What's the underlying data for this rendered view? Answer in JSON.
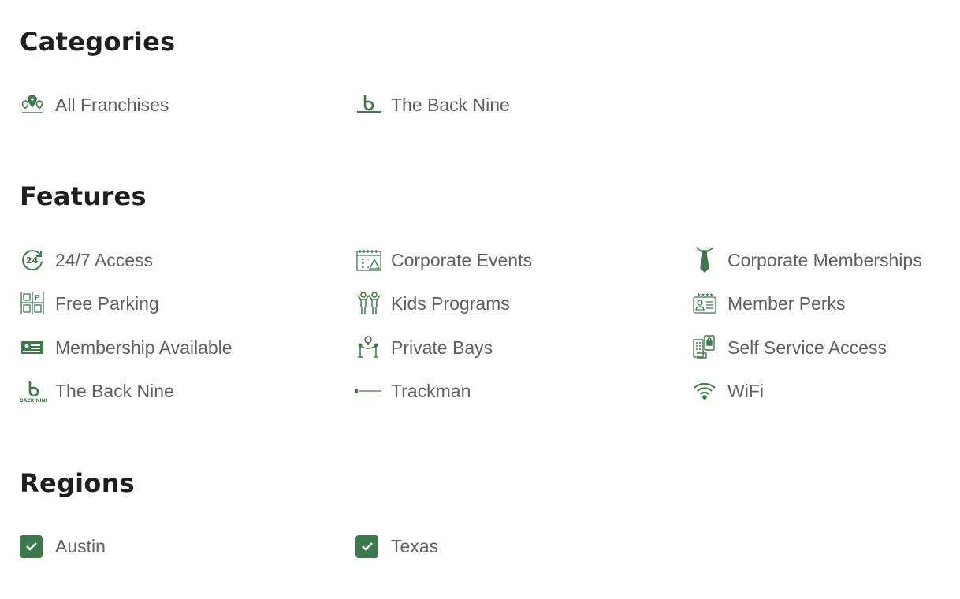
{
  "categories": {
    "title": "Categories",
    "items": [
      {
        "label": "All Franchises",
        "icon": "map-pins-icon"
      },
      {
        "label": "The Back Nine",
        "icon": "back-nine-logo-icon"
      }
    ]
  },
  "features": {
    "title": "Features",
    "items": [
      {
        "label": "24/7 Access",
        "icon": "24-hour-icon"
      },
      {
        "label": "Corporate Events",
        "icon": "calendar-event-icon"
      },
      {
        "label": "Corporate Memberships",
        "icon": "necktie-icon"
      },
      {
        "label": "Free Parking",
        "icon": "parking-icon"
      },
      {
        "label": "Kids Programs",
        "icon": "kids-icon"
      },
      {
        "label": "Member Perks",
        "icon": "member-card-icon"
      },
      {
        "label": "Membership Available",
        "icon": "membership-card-icon"
      },
      {
        "label": "Private Bays",
        "icon": "private-bay-icon"
      },
      {
        "label": "Self Service Access",
        "icon": "keypad-access-icon"
      },
      {
        "label": "The Back Nine",
        "icon": "back-nine-logo-icon"
      },
      {
        "label": "Trackman",
        "icon": "trackman-logo-icon"
      },
      {
        "label": "WiFi",
        "icon": "wifi-icon"
      }
    ]
  },
  "regions": {
    "title": "Regions",
    "items": [
      {
        "label": "Austin",
        "checked": true,
        "icon": "checkbox-checked-icon"
      },
      {
        "label": "Texas",
        "checked": true,
        "icon": "checkbox-checked-icon"
      }
    ]
  },
  "colors": {
    "accent": "#3b7a48",
    "heading": "#1e1e1e",
    "text": "#5f5f5f"
  }
}
